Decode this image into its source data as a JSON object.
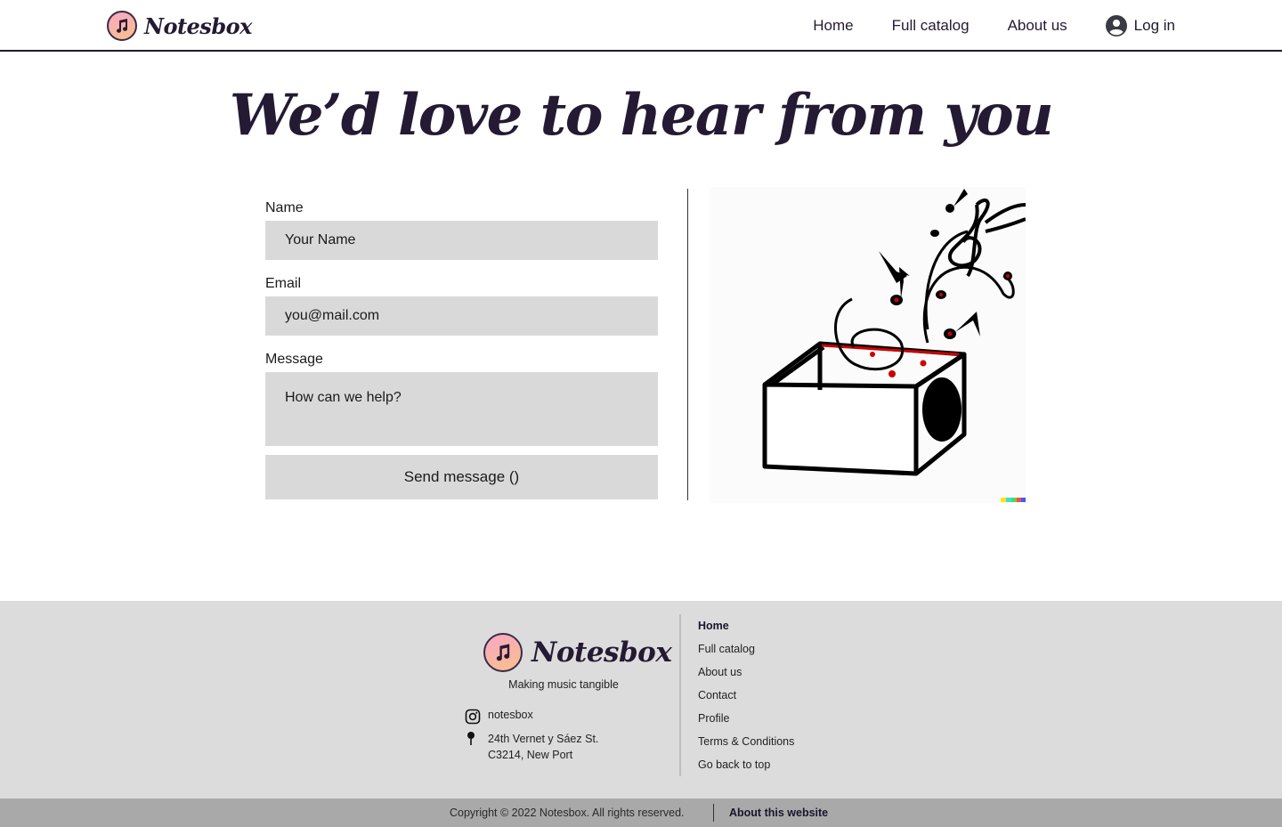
{
  "header": {
    "brand": "Notesbox",
    "nav": [
      "Home",
      "Full catalog",
      "About us"
    ],
    "login_label": "Log in"
  },
  "title": "We’d love to hear from you",
  "form": {
    "name_label": "Name",
    "name_placeholder": "Your Name",
    "email_label": "Email",
    "email_placeholder": "you@mail.com",
    "message_label": "Message",
    "message_placeholder": "How can we help?",
    "send_label": "Send message ()"
  },
  "footer": {
    "brand": "Notesbox",
    "tagline": "Making music tangible",
    "instagram": "notesbox",
    "address_line1": "24th Vernet y Sáez St.",
    "address_line2": "C3214, New Port",
    "links": [
      "Home",
      "Full catalog",
      "About us",
      "Contact",
      "Profile",
      "Terms & Conditions",
      "Go back to top"
    ],
    "copyright": "Copyright  © 2022 Notesbox. All rights reserved.",
    "about_site": "About this website"
  },
  "colors": {
    "accent_dark": "#241a33",
    "field_bg": "#d9d9d9",
    "footer_bg": "#dcdcdd",
    "copybar_bg": "#a9a9a9",
    "logo_gradient_start": "#f7a8c4",
    "logo_gradient_end": "#f9c08a"
  },
  "icons": {
    "logo": "music-note-icon",
    "login": "user-circle-icon",
    "instagram": "instagram-icon",
    "address": "map-pin-icon"
  }
}
